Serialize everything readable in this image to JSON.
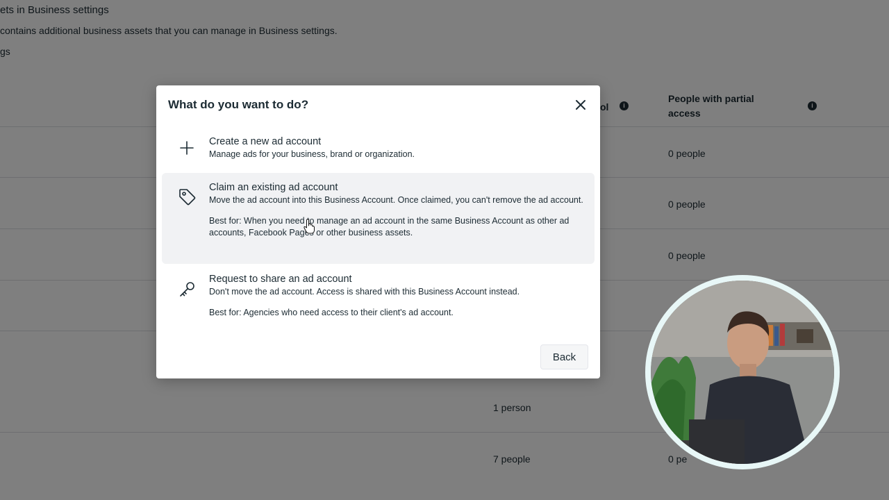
{
  "background": {
    "header_title": "ets in Business settings",
    "header_desc": "contains additional business assets that you can manage in Business settings.",
    "header_link": "gs",
    "col_full_control": "ol",
    "col_partial_access": "People with partial access",
    "rows": [
      {
        "full": "",
        "partial": "0 people"
      },
      {
        "full": "",
        "partial": "0 people"
      },
      {
        "full": "",
        "partial": "0 people"
      },
      {
        "full": "",
        "partial": ""
      },
      {
        "full": "1 person",
        "partial": ""
      },
      {
        "full": "7 people",
        "partial": "0 pe"
      }
    ]
  },
  "dialog": {
    "title": "What do you want to do?",
    "close_icon": "close-icon",
    "options": [
      {
        "icon": "plus-icon",
        "title": "Create a new ad account",
        "desc": "Manage ads for your business, brand or organization."
      },
      {
        "icon": "tag-icon",
        "title": "Claim an existing ad account",
        "desc": "Move the ad account into this Business Account. Once claimed, you can't remove the ad account.",
        "best": "Best for: When you need to manage an ad account in the same Business Account as other ad accounts, Facebook Pages or other business assets."
      },
      {
        "icon": "key-icon",
        "title": "Request to share an ad account",
        "desc": "Don't move the ad account. Access is shared with this Business Account instead.",
        "best": "Best for: Agencies who need access to their client's ad account."
      }
    ],
    "back_label": "Back"
  },
  "colors": {
    "text": "#1c2b33",
    "hover_bg": "#f1f2f4",
    "cam_ring": "#e8f7f7"
  }
}
